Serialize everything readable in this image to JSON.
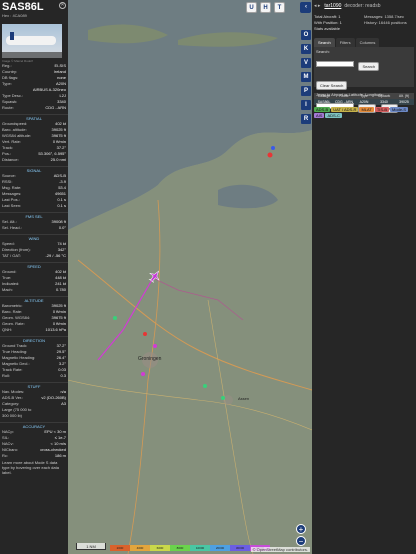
{
  "aircraft": {
    "callsign": "SAS86L",
    "hex": "Hex : 4CA089",
    "photo_credit": "Image © Marcel Rudolf"
  },
  "info_rows": [
    {
      "k": "Reg.:",
      "v": "EI-SIS"
    },
    {
      "k": "Country:",
      "v": "Ireland"
    },
    {
      "k": "DB flags:",
      "v": "none"
    },
    {
      "k": "Type:",
      "v": "A20N"
    },
    {
      "k": "",
      "v": "AIRBUS A-320neo"
    },
    {
      "k": "Type Desc.:",
      "v": "L2J"
    },
    {
      "k": "Squawk:",
      "v": "3340"
    },
    {
      "k": "Route:",
      "v": "CDG - ARN"
    }
  ],
  "spatial": {
    "title": "SPATIAL",
    "rows": [
      {
        "k": "Groundspeed:",
        "v": "402 kt"
      },
      {
        "k": "Baro. altitude:",
        "v": "39025 ft"
      },
      {
        "k": "WGS84 altitude:",
        "v": "39675 ft"
      },
      {
        "k": "Vert. Rate:",
        "v": "0 ft/min"
      },
      {
        "k": "Track:",
        "v": "37.2°"
      },
      {
        "k": "Pos.:",
        "v": "53.306°, 6.595°"
      },
      {
        "k": "Distance:",
        "v": "25.0 nmi"
      }
    ]
  },
  "signal": {
    "title": "SIGNAL",
    "rows": [
      {
        "k": "Source:",
        "v": "ADS-B"
      },
      {
        "k": "RSSI:",
        "v": "-3.9"
      },
      {
        "k": "Msg. Rate:",
        "v": "53.4"
      },
      {
        "k": "Messages:",
        "v": "49651"
      },
      {
        "k": "Last Pos.:",
        "v": "0.1 s"
      },
      {
        "k": "Last Seen:",
        "v": "0.1 s"
      }
    ]
  },
  "fms": {
    "title": "FMS SEL",
    "rows": [
      {
        "k": "Sel. Alt.:",
        "v": "39008 ft"
      },
      {
        "k": "Sel. Head.:",
        "v": "0.0°"
      }
    ]
  },
  "wind": {
    "title": "WIND",
    "rows": [
      {
        "k": "Speed:",
        "v": "74 kt"
      },
      {
        "k": "Direction (from):",
        "v": "342°"
      },
      {
        "k": "TAT / OAT:",
        "v": "-29 / -56 °C"
      }
    ]
  },
  "speed": {
    "title": "SPEED",
    "rows": [
      {
        "k": "Ground:",
        "v": "402 kt"
      },
      {
        "k": "True:",
        "v": "448 kt"
      },
      {
        "k": "Indicated:",
        "v": "241 kt"
      },
      {
        "k": "Mach:",
        "v": "0.780"
      }
    ]
  },
  "altitude": {
    "title": "ALTITUDE",
    "rows": [
      {
        "k": "Barometric:",
        "v": "39025 ft"
      },
      {
        "k": "Baro. Rate:",
        "v": "0 ft/min"
      },
      {
        "k": "Geom. WGS84:",
        "v": "39675 ft"
      },
      {
        "k": "Geom. Rate:",
        "v": "0 ft/min"
      },
      {
        "k": "QNH:",
        "v": "1013.6 hPa"
      }
    ]
  },
  "direction": {
    "title": "DIRECTION",
    "rows": [
      {
        "k": "Ground Track:",
        "v": "37.2°"
      },
      {
        "k": "True Heading:",
        "v": "29.5°"
      },
      {
        "k": "Magnetic Heading:",
        "v": "26.4°"
      },
      {
        "k": "Magnetic Decl.:",
        "v": "3.2°"
      },
      {
        "k": "Track Rate:",
        "v": "0.03"
      },
      {
        "k": "Roll:",
        "v": "0.3"
      }
    ]
  },
  "stuff": {
    "title": "STUFF",
    "rows": [
      {
        "k": "Nav. Modes:",
        "v": "n/a"
      },
      {
        "k": "ADS-B Ver.:",
        "v": "v2 (DO-260B)"
      },
      {
        "k": "Category:",
        "v": "A3"
      },
      {
        "k": "Large (75 000 to",
        "v": ""
      },
      {
        "k": "300 000 lb)",
        "v": ""
      }
    ]
  },
  "accuracy": {
    "title": "ACCURACY",
    "rows": [
      {
        "k": "NACp:",
        "v": "EPU < 30 m"
      },
      {
        "k": "SIL:",
        "v": "≤ 1e-7"
      },
      {
        "k": "NACv:",
        "v": "< 10 m/s"
      },
      {
        "k": "NICbaro:",
        "v": "cross-checked"
      },
      {
        "k": "Rc:",
        "v": "186 m"
      }
    ]
  },
  "learn_more": "Learn more about Mode S data type by hovering over each data label.",
  "map": {
    "top_buttons": [
      "U",
      "H",
      "T"
    ],
    "side_buttons": [
      "O",
      "K",
      "V",
      "M",
      "P",
      "I",
      "R"
    ],
    "places": [
      "Groningen",
      "Assen"
    ],
    "scale": "1 NM",
    "alt_legend": [
      "2000",
      "4000",
      "6000",
      "8000",
      "10000",
      "20000",
      "30000",
      "40000"
    ],
    "attribution": "© OpenStreetMap contributors."
  },
  "right": {
    "arrows": "◂ ▸",
    "app_name": "tar1090",
    "decoder": "decoder: readsb",
    "total_aircraft": "Total Aircraft: 1",
    "with_position": "With Position: 1",
    "stats_available": "Stats available",
    "messages": "Messages: 1358.7/sec",
    "history": "History: 16446 positions",
    "tabs": [
      "Search",
      "Filters",
      "Columns"
    ],
    "search_label": "Search:",
    "search_button": "Search",
    "clear_search": "Clear Search",
    "jump_label": "Jump to Airport or Latitude, Longitude:",
    "jump_button": "Jump",
    "clear_button": "Clear",
    "table_headers": [
      "Callsign",
      "Route",
      "Type",
      "Squawk",
      "Alt. (ft)"
    ],
    "table_row": [
      "SAS86L",
      "CDG - ARN",
      "A20N",
      "3340",
      "39025"
    ],
    "legend": [
      {
        "label": "ADS-B",
        "color": "#4fa84f"
      },
      {
        "label": "UAT / ADS-R",
        "color": "#c6b24a"
      },
      {
        "label": "MLAT",
        "color": "#e38b3a"
      },
      {
        "label": "TIS-B",
        "color": "#d35d5d"
      },
      {
        "label": "Mode-S",
        "color": "#6c89c6"
      },
      {
        "label": "AIS",
        "color": "#a47ad5"
      },
      {
        "label": "ADS-C",
        "color": "#7ec2c2"
      }
    ]
  }
}
